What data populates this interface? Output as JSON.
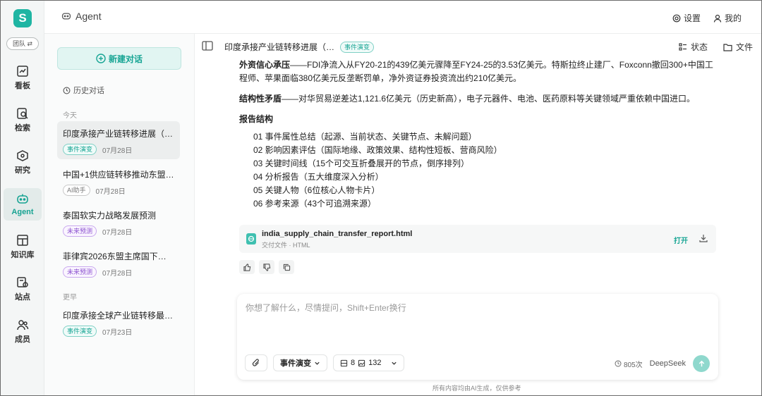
{
  "rail": {
    "logo": "S",
    "team_label": "团队 ⇄",
    "items": [
      {
        "label": "看板",
        "icon": "chart-icon"
      },
      {
        "label": "检索",
        "icon": "search-doc-icon"
      },
      {
        "label": "研究",
        "icon": "cube-icon"
      },
      {
        "label": "Agent",
        "icon": "agent-icon",
        "active": true
      },
      {
        "label": "知识库",
        "icon": "book-icon"
      },
      {
        "label": "站点",
        "icon": "location-icon"
      },
      {
        "label": "成员",
        "icon": "users-icon"
      }
    ]
  },
  "topbar": {
    "title": "Agent",
    "settings_label": "设置",
    "profile_label": "我的"
  },
  "sidebar": {
    "new_chat_label": "新建对话",
    "history_label": "历史对话",
    "section_today": "今天",
    "section_earlier": "更早",
    "conversations": [
      {
        "title": "印度承接产业链转移进展（…",
        "badge": "事件演变",
        "badge_color": "teal",
        "date": "07月28日",
        "active": true
      },
      {
        "title": "中国+1供应链转移推动东盟…",
        "badge": "AI助手",
        "badge_color": "gray",
        "date": "07月28日"
      },
      {
        "title": "泰国软实力战略发展预测",
        "badge": "未来预测",
        "badge_color": "purple",
        "date": "07月28日"
      },
      {
        "title": "菲律宾2026东盟主席国下…",
        "badge": "未来预测",
        "badge_color": "purple",
        "date": "07月28日"
      },
      {
        "title": "印度承接全球产业链转移最…",
        "badge": "事件演变",
        "badge_color": "teal",
        "date": "07月23日"
      }
    ]
  },
  "main": {
    "title": "印度承接产业链转移进展（…",
    "title_badge": "事件演变",
    "status_label": "状态",
    "file_label": "文件",
    "para1": "外资信心承压——FDI净流入从FY20-21的439亿美元骤降至FY24-25的3.53亿美元。特斯拉终止建厂、Foxconn撤回300+中国工程师、苹果面临380亿美元反垄断罚单，净外资证券投资流出约210亿美元。",
    "para2": "结构性矛盾——对华贸易逆差达1,121.6亿美元（历史新高），电子元器件、电池、医药原料等关键领域严重依赖中国进口。",
    "para2_lead": "结构性矛盾",
    "report_heading": "报告结构",
    "report_items": [
      "01 事件属性总结（起源、当前状态、关键节点、未解问题）",
      "02 影响因素评估（国际地缘、政策效果、结构性短板、营商风险）",
      "03 关键时间线（15个可交互折叠展开的节点，倒序排列）",
      "04 分析报告（五大维度深入分析）",
      "05 关键人物（6位核心人物卡片）",
      "06 参考来源（43个可追溯来源）"
    ],
    "file": {
      "name": "india_supply_chain_transfer_report.html",
      "sub": "交付文件 · HTML",
      "open_label": "打开"
    }
  },
  "composer": {
    "placeholder": "你想了解什么，尽情提问，Shift+Enter换行",
    "mode_label": "事件演变",
    "count_a": "8",
    "count_b": "132",
    "usage": "805次",
    "model": "DeepSeek"
  },
  "footer": "所有内容均由AI生成，仅供参考",
  "colors": {
    "accent": "#17a594",
    "accent_light": "#e1f5f2"
  }
}
